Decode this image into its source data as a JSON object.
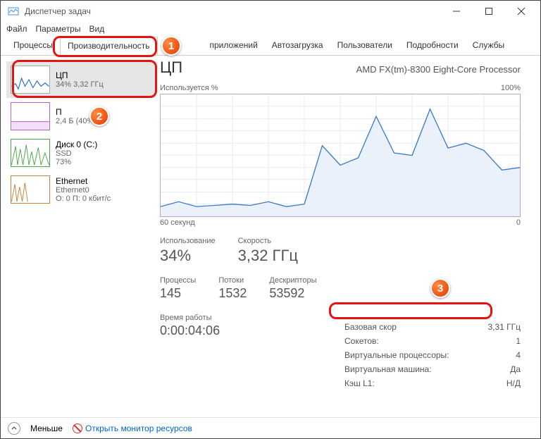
{
  "window": {
    "title": "Диспетчер задач"
  },
  "menu": {
    "file": "Файл",
    "options": "Параметры",
    "view": "Вид"
  },
  "tabs": {
    "processes": "Процессы",
    "performance": "Производительность",
    "apphistory": "приложений",
    "startup": "Автозагрузка",
    "users": "Пользователи",
    "details": "Подробности",
    "services": "Службы"
  },
  "sidebar": {
    "cpu": {
      "title": "ЦП",
      "sub": "34% 3,32 ГГц"
    },
    "mem": {
      "title": "П",
      "sub": "2,4         Б (40%)"
    },
    "disk": {
      "title": "Диск 0 (C:)",
      "sub": "SSD",
      "sub2": "73%"
    },
    "eth": {
      "title": "Ethernet",
      "sub": "Ethernet0",
      "sub2": "О: 0 П: 0 кбит/с"
    }
  },
  "main": {
    "title": "ЦП",
    "model": "AMD FX(tm)-8300 Eight-Core Processor",
    "chart_top_left": "Используется %",
    "chart_top_right": "100%",
    "axis_left": "60 секунд",
    "axis_right": "0"
  },
  "stats": {
    "util_lab": "Использование",
    "util_val": "34%",
    "speed_lab": "Скорость",
    "speed_val": "3,32 ГГц",
    "proc_lab": "Процессы",
    "proc_val": "145",
    "thr_lab": "Потоки",
    "thr_val": "1532",
    "hnd_lab": "Дескрипторы",
    "hnd_val": "53592",
    "up_lab": "Время работы",
    "up_val": "0:00:04:06"
  },
  "kv": {
    "base_lab": "Базовая скор",
    "base_val": "3,31 ГГц",
    "sock_lab": "Сокетов:",
    "sock_val": "1",
    "vproc_lab": "Виртуальные процессоры:",
    "vproc_val": "4",
    "vm_lab": "Виртуальная машина:",
    "vm_val": "Да",
    "l1_lab": "Кэш L1:",
    "l1_val": "Н/Д"
  },
  "footer": {
    "less": "Меньше",
    "resmon": "Открыть монитор ресурсов"
  },
  "annot": {
    "b1": "1",
    "b2": "2",
    "b3": "3"
  },
  "chart_data": {
    "type": "line",
    "title": "Используется %",
    "xlabel": "60 секунд",
    "ylabel": "",
    "ylim": [
      0,
      100
    ],
    "x": [
      0,
      5,
      10,
      15,
      20,
      25,
      30,
      35,
      40,
      45,
      50,
      55,
      60,
      65,
      70,
      75,
      80,
      85,
      90,
      95,
      100
    ],
    "values": [
      8,
      12,
      8,
      9,
      10,
      9,
      12,
      8,
      10,
      58,
      42,
      48,
      82,
      52,
      50,
      88,
      56,
      60,
      54,
      38,
      40
    ]
  }
}
